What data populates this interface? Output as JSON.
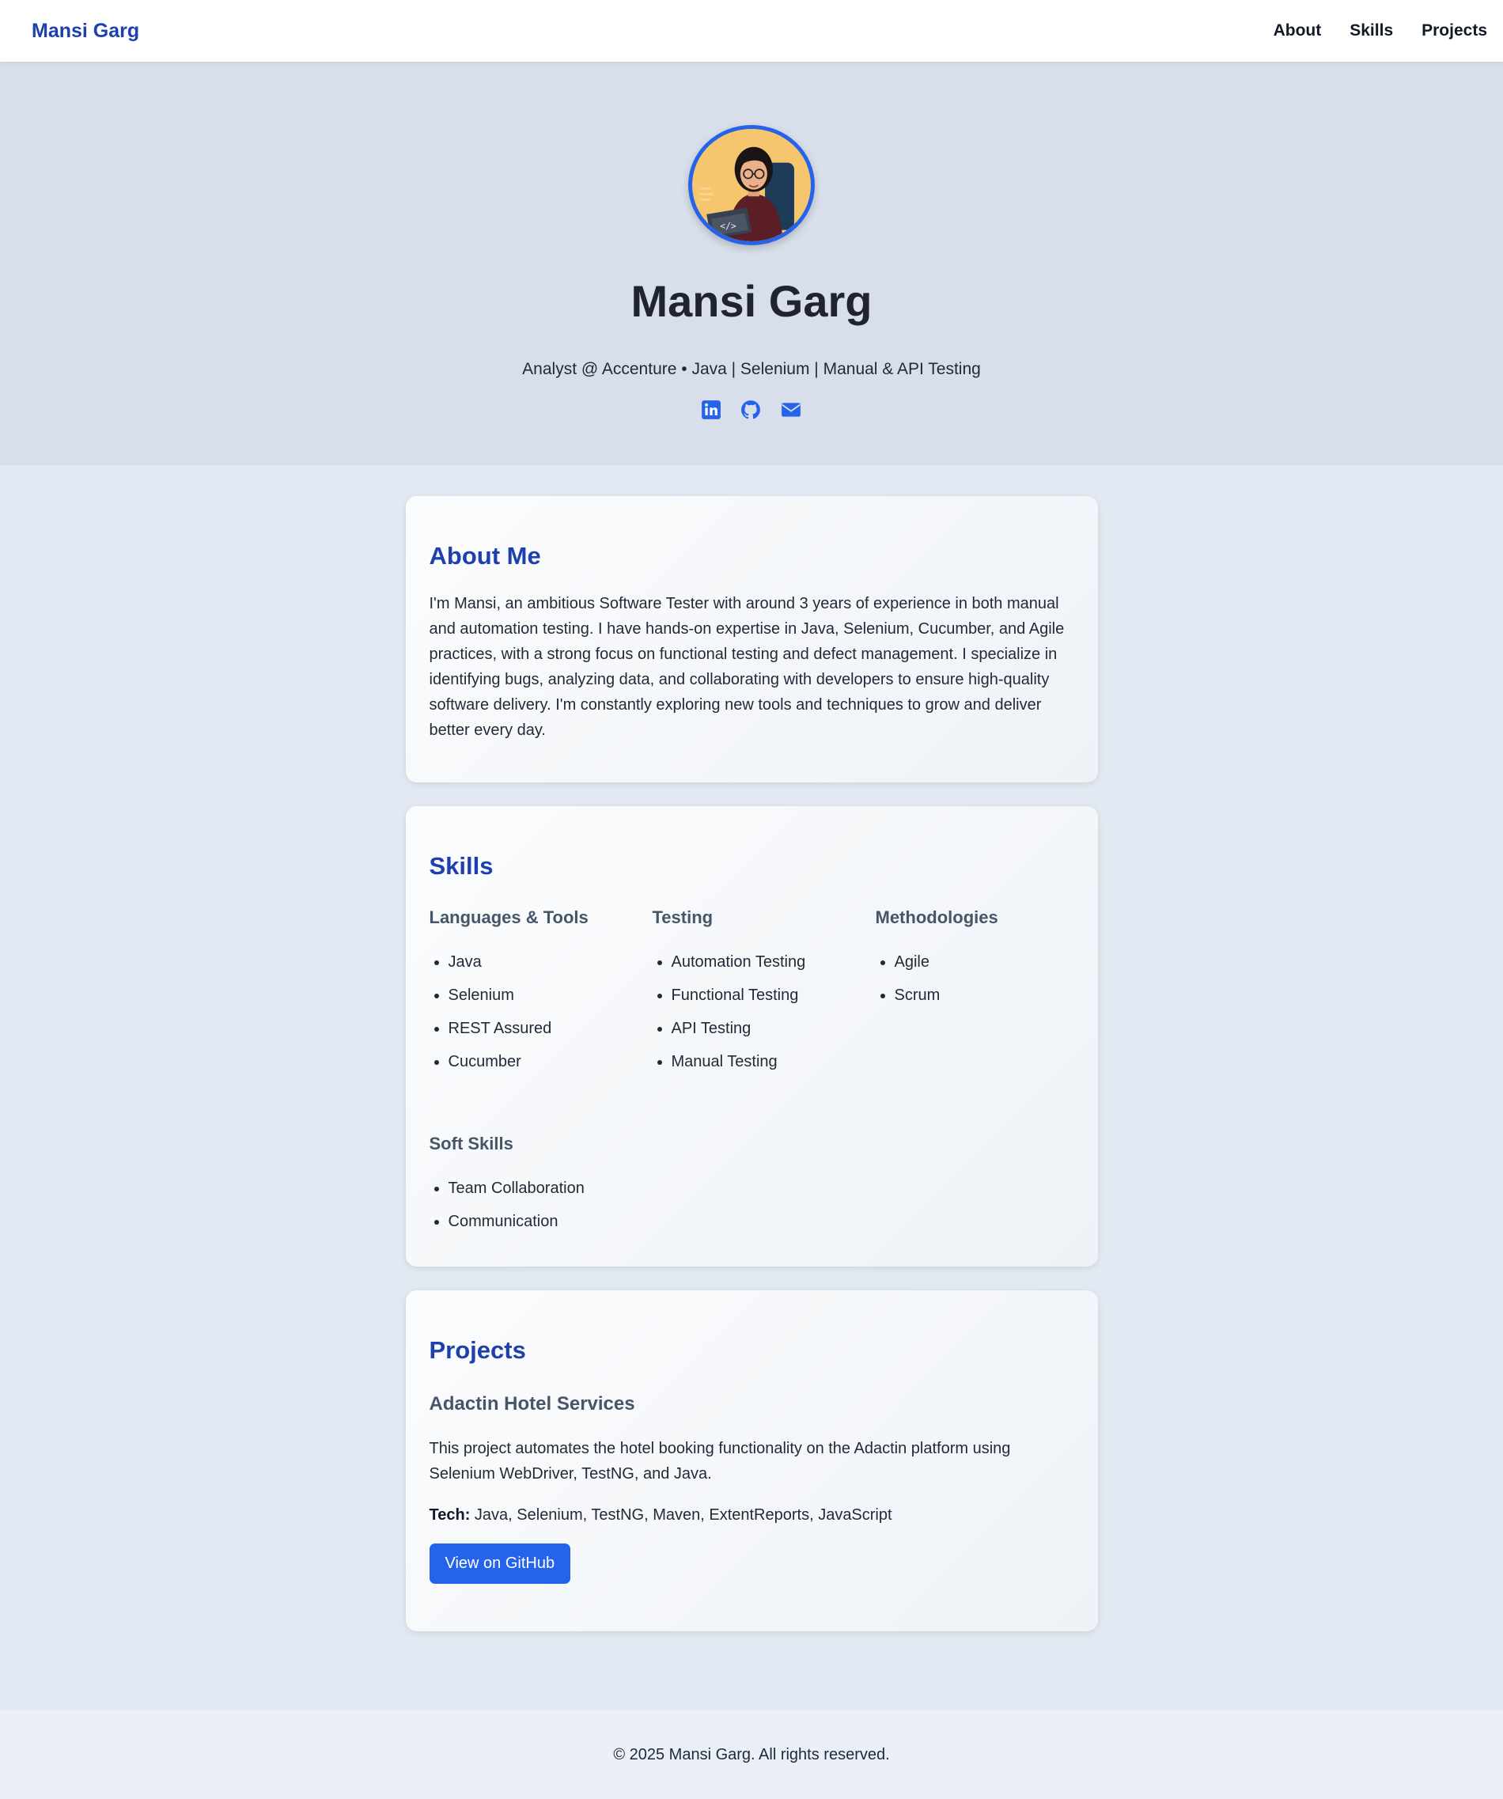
{
  "nav": {
    "brand": "Mansi Garg",
    "links": [
      "About",
      "Skills",
      "Projects"
    ]
  },
  "hero": {
    "name": "Mansi Garg",
    "tagline": "Analyst @ Accenture • Java | Selenium | Manual & API Testing",
    "socials": [
      "linkedin-icon",
      "github-icon",
      "email-icon"
    ],
    "accent_color": "#2563eb"
  },
  "about": {
    "title": "About Me",
    "text": "I'm Mansi, an ambitious Software Tester with around 3 years of experience in both manual and automation testing. I have hands-on expertise in Java, Selenium, Cucumber, and Agile practices, with a strong focus on functional testing and defect management. I specialize in identifying bugs, analyzing data, and collaborating with developers to ensure high-quality software delivery. I'm constantly exploring new tools and techniques to grow and deliver better every day."
  },
  "skills": {
    "title": "Skills",
    "groups": [
      {
        "title": "Languages & Tools",
        "items": [
          "Java",
          "Selenium",
          "REST Assured",
          "Cucumber"
        ]
      },
      {
        "title": "Testing",
        "items": [
          "Automation Testing",
          "Functional Testing",
          "API Testing",
          "Manual Testing"
        ]
      },
      {
        "title": "Methodologies",
        "items": [
          "Agile",
          "Scrum"
        ]
      },
      {
        "title": "Soft Skills",
        "items": [
          "Team Collaboration",
          "Communication"
        ]
      }
    ]
  },
  "projects": {
    "title": "Projects",
    "items": [
      {
        "name": "Adactin Hotel Services",
        "description": "This project automates the hotel booking functionality on the Adactin platform using Selenium WebDriver, TestNG, and Java.",
        "tech_label": "Tech:",
        "tech": "Java, Selenium, TestNG, Maven, ExtentReports, JavaScript",
        "button": "View on GitHub"
      }
    ]
  },
  "footer": {
    "text": "© 2025 Mansi Garg. All rights reserved."
  }
}
